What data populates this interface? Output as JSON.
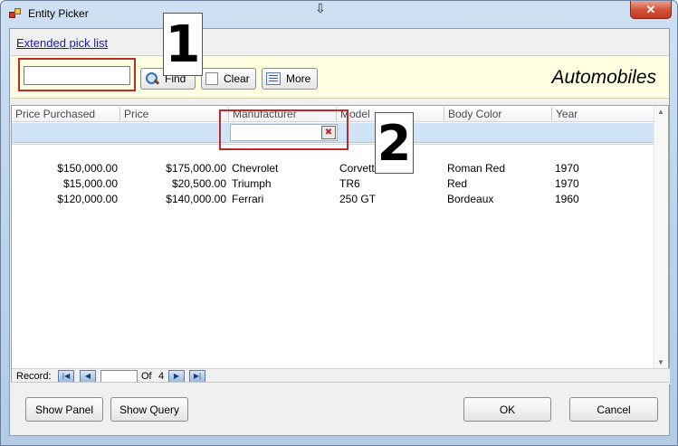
{
  "window": {
    "title": "Entity Picker",
    "close_glyph": "✕",
    "move_glyph": "⇩"
  },
  "link": {
    "extended_pick_list": "Extended pick list"
  },
  "toolbar": {
    "search_value": "",
    "find_label": "Find",
    "clear_label": "Clear",
    "more_label": "More",
    "entity_title": "Automobiles"
  },
  "grid": {
    "columns": [
      "Price Purchased",
      "Price",
      "Manufacturer",
      "Model",
      "Body Color",
      "Year"
    ],
    "rows": [
      [
        "$150,000.00",
        "$175,000.00",
        "Chevrolet",
        "Corvette",
        "Roman Red",
        "1970"
      ],
      [
        "$15,000.00",
        "$20,500.00",
        "Triumph",
        "TR6",
        "Red",
        "1970"
      ],
      [
        "$120,000.00",
        "$140,000.00",
        "Ferrari",
        "250 GT",
        "Bordeaux",
        "1960"
      ]
    ],
    "filter_manufacturer_value": ""
  },
  "navigator": {
    "record_label": "Record:",
    "record_value": "",
    "of_label": "Of",
    "total": "4"
  },
  "buttons": {
    "show_panel": "Show Panel",
    "show_query": "Show Query",
    "ok": "OK",
    "cancel": "Cancel"
  },
  "callouts": {
    "one": "1",
    "two": "2"
  },
  "colors": {
    "toolbar_bg": "#ffffe1",
    "filter_row_bg": "#cfe4f7",
    "highlight_red": "#c0282d"
  }
}
